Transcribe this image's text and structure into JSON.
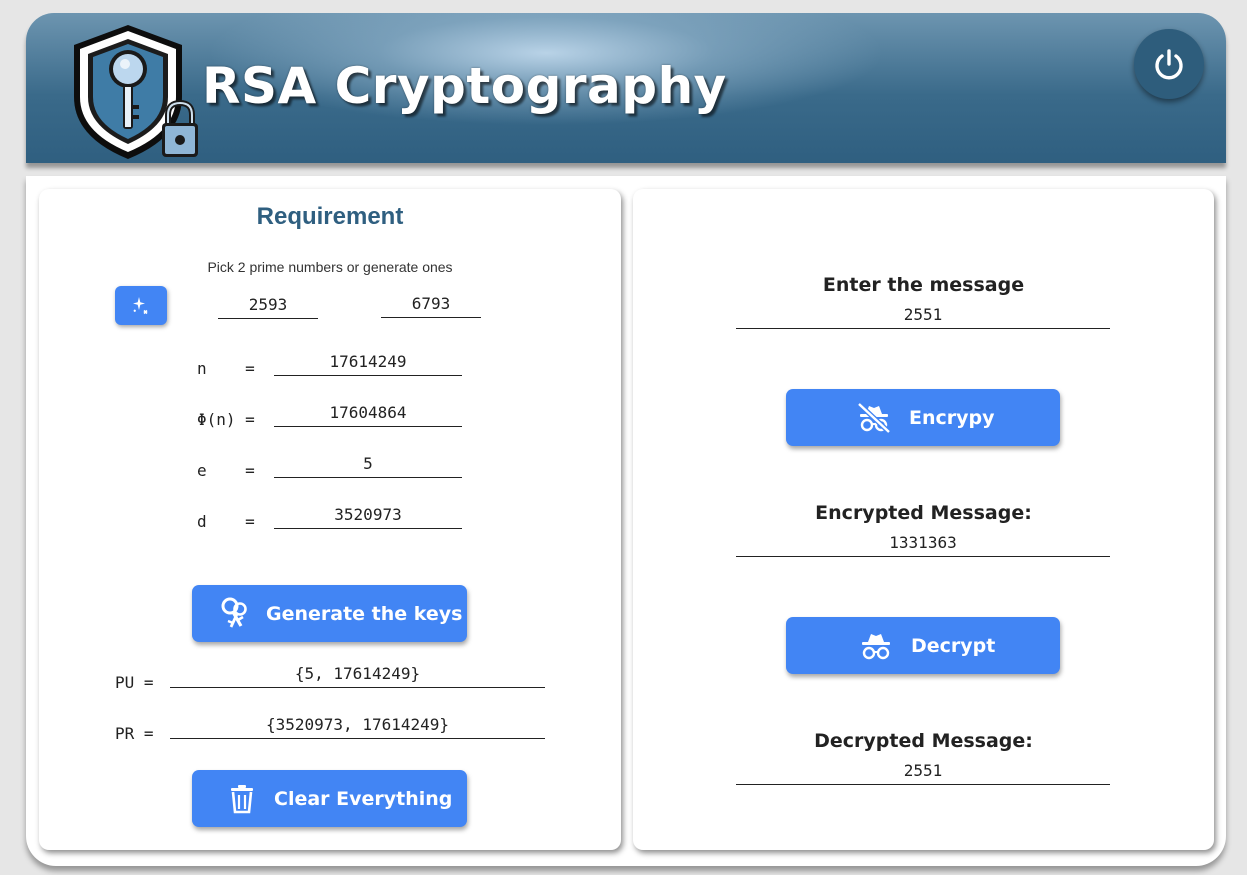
{
  "header": {
    "app_title": "RSA Cryptography",
    "power_icon": "power-icon",
    "logo_icon": "shield-key-lock-icon",
    "colors": {
      "header_dark": "#2f5f80",
      "accent": "#4285f4"
    }
  },
  "requirement": {
    "title": "Requirement",
    "subtitle": "Pick 2 prime numbers or generate ones",
    "generate_primes_icon": "sparkles-icon",
    "prime_p": "2593",
    "prime_q": "6793",
    "n_label": "n    =",
    "n_value": "17614249",
    "phi_label": "Φ(n) =",
    "phi_value": "17604864",
    "e_label": "e    =",
    "e_value": "5",
    "d_label": "d    =",
    "d_value": "3520973",
    "generate_keys_label": "Generate the keys",
    "pu_label": "PU =",
    "pu_value": "{5, 17614249}",
    "pr_label": "PR =",
    "pr_value": "{3520973, 17614249}",
    "clear_label": "Clear Everything"
  },
  "crypto": {
    "enter_label": "Enter the message",
    "message_value": "2551",
    "encrypt_label": "Encrypy",
    "encrypted_label": "Encrypted Message:",
    "encrypted_value": "1331363",
    "decrypt_label": "Decrypt",
    "decrypted_label": "Decrypted Message:",
    "decrypted_value": "2551"
  }
}
